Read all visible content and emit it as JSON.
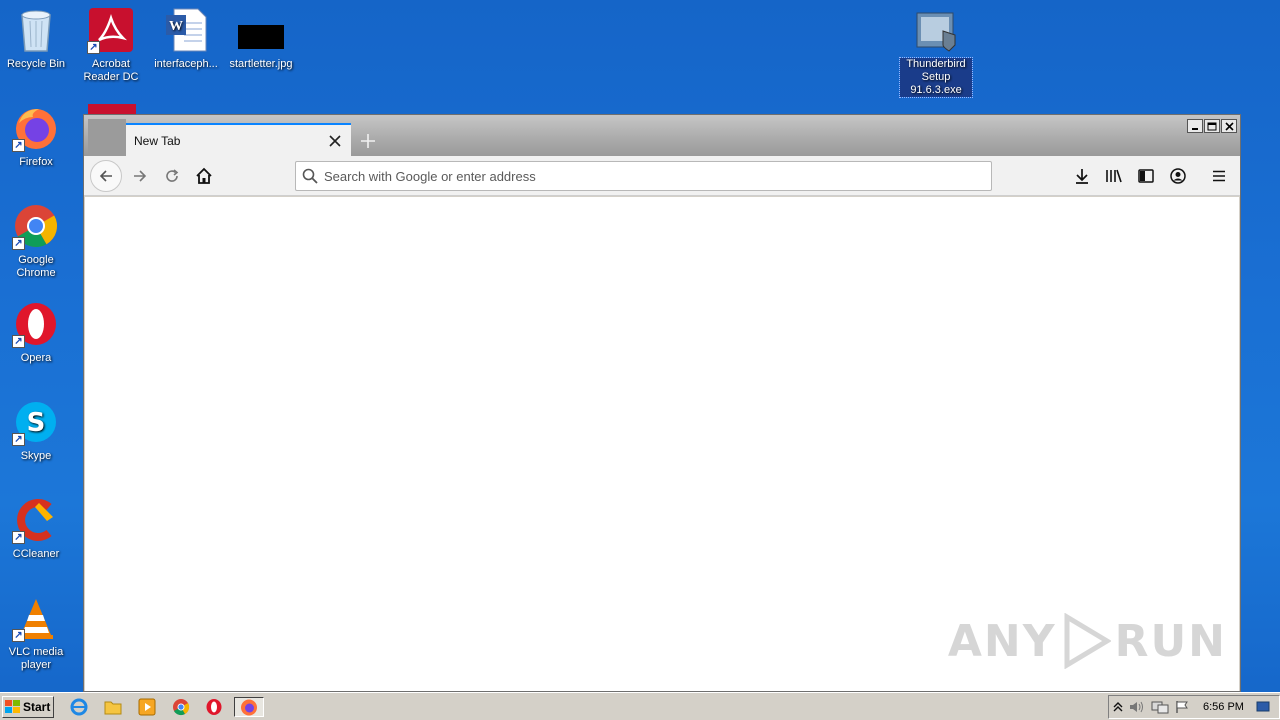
{
  "desktop": {
    "icons": [
      {
        "label": "Recycle Bin"
      },
      {
        "label": "Acrobat Reader DC"
      },
      {
        "label": "interfaceph..."
      },
      {
        "label": "startletter.jpg"
      },
      {
        "label": "Thunderbird Setup 91.6.3.exe"
      },
      {
        "label": "Firefox"
      },
      {
        "label": "Google Chrome"
      },
      {
        "label": "Opera"
      },
      {
        "label": "Skype"
      },
      {
        "label": "CCleaner"
      },
      {
        "label": "VLC media player"
      }
    ]
  },
  "browser": {
    "tab_title": "New Tab",
    "url_placeholder": "Search with Google or enter address",
    "url_value": ""
  },
  "watermark": {
    "text_left": "ANY",
    "text_right": "RUN"
  },
  "taskbar": {
    "start_label": "Start",
    "clock": "6:56 PM"
  },
  "colors": {
    "desktop_bg": "#1a6fd3",
    "tab_accent": "#0a84ff",
    "taskbar": "#d4d0c8"
  }
}
